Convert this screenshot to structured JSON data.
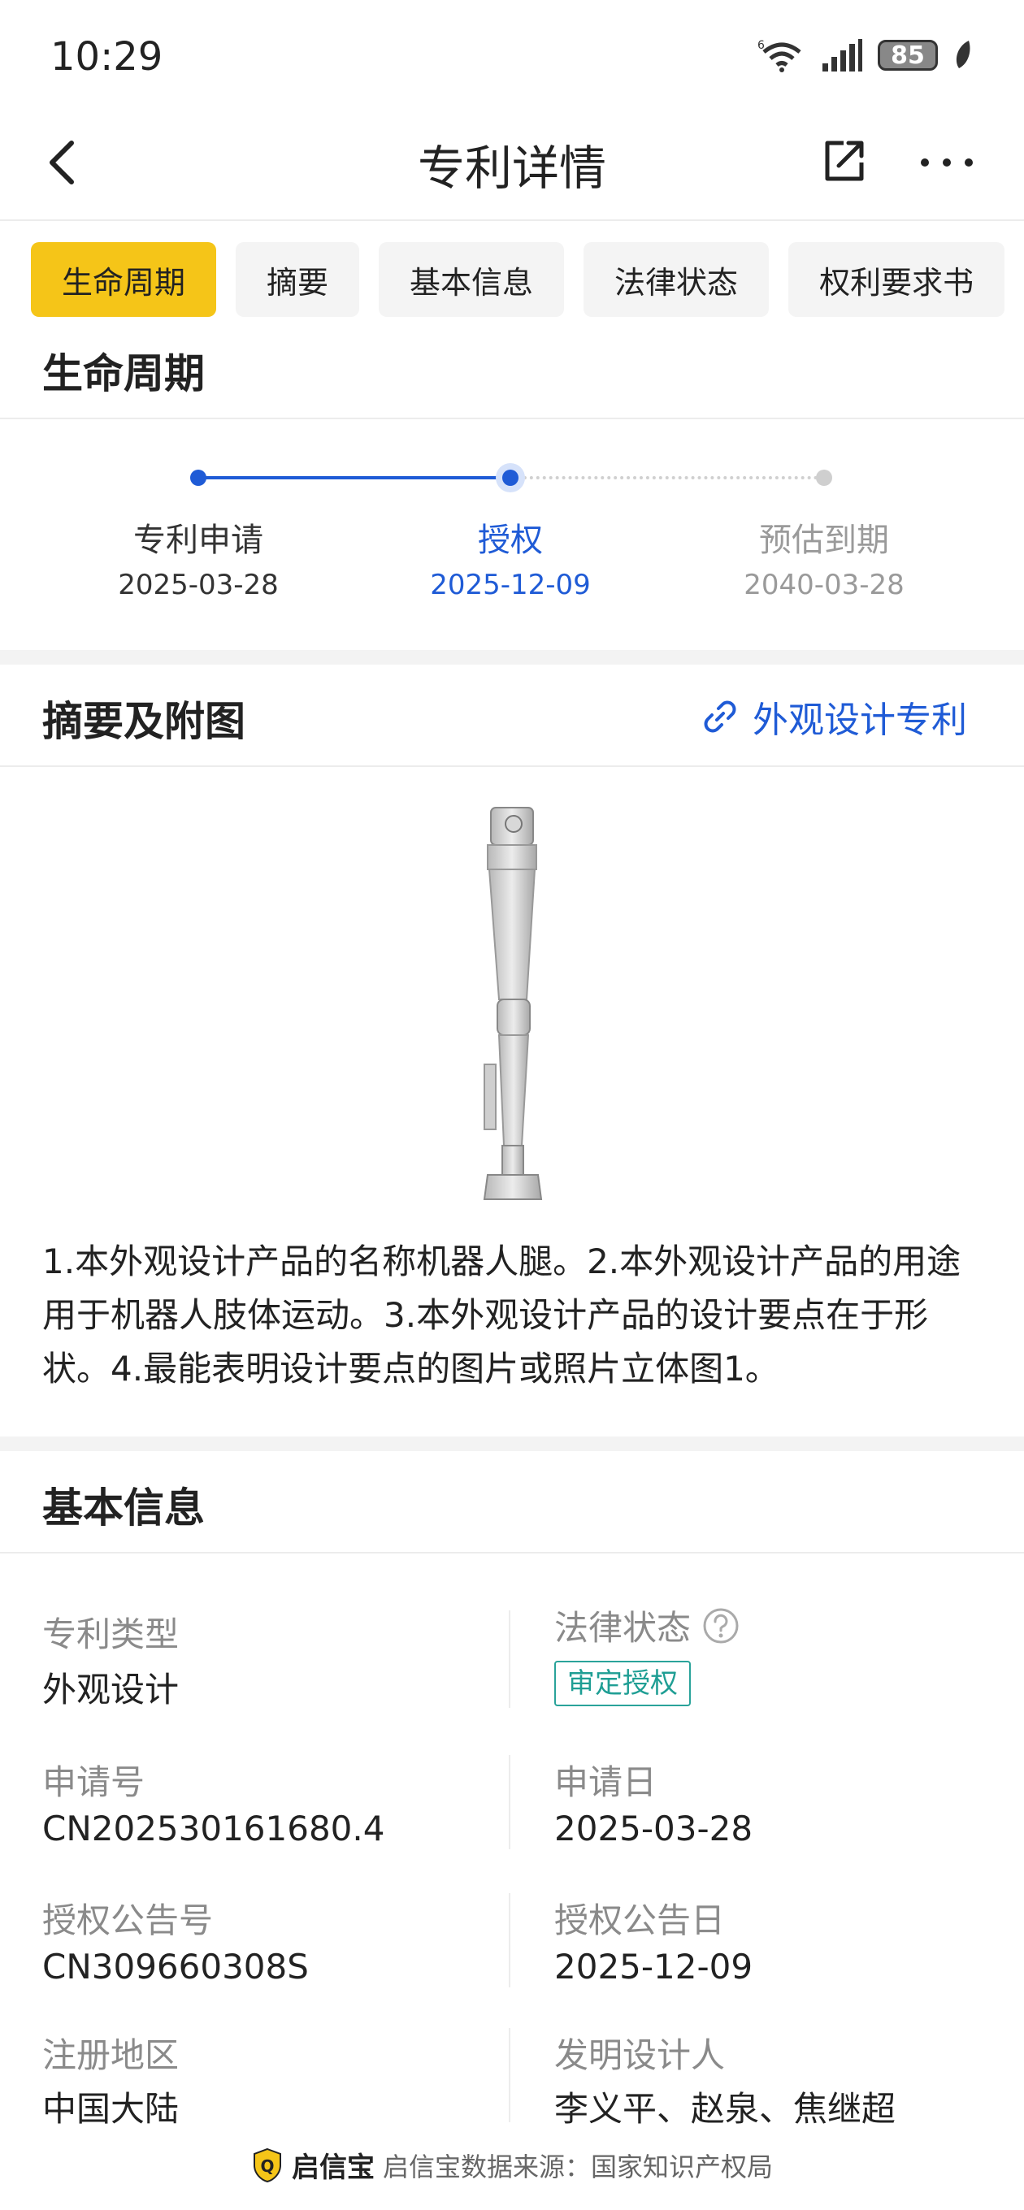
{
  "status_bar": {
    "time": "10:29",
    "battery": "85",
    "network_label": "6"
  },
  "nav": {
    "title": "专利详情"
  },
  "tabs": [
    {
      "label": "生命周期",
      "active": true
    },
    {
      "label": "摘要",
      "active": false
    },
    {
      "label": "基本信息",
      "active": false
    },
    {
      "label": "法律状态",
      "active": false
    },
    {
      "label": "权利要求书",
      "active": false
    }
  ],
  "lifecycle": {
    "title": "生命周期",
    "steps": [
      {
        "label": "专利申请",
        "date": "2025-03-28",
        "state": "done"
      },
      {
        "label": "授权",
        "date": "2025-12-09",
        "state": "current"
      },
      {
        "label": "预估到期",
        "date": "2040-03-28",
        "state": "future"
      }
    ]
  },
  "summary": {
    "title": "摘要及附图",
    "link_label": "外观设计专利",
    "text": "1.本外观设计产品的名称机器人腿。2.本外观设计产品的用途用于机器人肢体运动。3.本外观设计产品的设计要点在于形状。4.最能表明设计要点的图片或照片立体图1。"
  },
  "basic_info": {
    "title": "基本信息",
    "patent_type_label": "专利类型",
    "patent_type": "外观设计",
    "legal_status_label": "法律状态",
    "legal_status": "审定授权",
    "application_no_label": "申请号",
    "application_no": "CN202530161680.4",
    "application_date_label": "申请日",
    "application_date": "2025-03-28",
    "grant_no_label": "授权公告号",
    "grant_no": "CN309660308S",
    "grant_date_label": "授权公告日",
    "grant_date": "2025-12-09",
    "region_label": "注册地区",
    "region": "中国大陆",
    "inventors_label": "发明设计人",
    "inventors": "李义平、赵泉、焦继超"
  },
  "footer": {
    "brand": "启信宝",
    "source": "启信宝数据来源：国家知识产权局"
  },
  "colors": {
    "accent_yellow": "#f5c518",
    "accent_blue": "#1f5bd6",
    "status_teal": "#2aa39a"
  }
}
